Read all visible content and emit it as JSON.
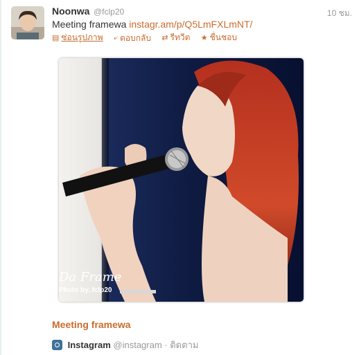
{
  "tweet": {
    "author_name": "Noonwa",
    "author_handle": "@fclp20",
    "time": "10 ชม.",
    "text": "Meeting framewa",
    "link": "instagr.am/p/Q5LmFXLmNT/",
    "actions": [
      {
        "label": "ซ่อนรูปภาพ",
        "icon": "image-icon"
      },
      {
        "label": "ตอบกลับ",
        "icon": "reply-icon"
      },
      {
        "label": "รีทวีต",
        "icon": "retweet-icon"
      },
      {
        "label": "ชื่นชอบ",
        "icon": "star-icon"
      }
    ]
  },
  "photo": {
    "watermark_script": "Da Frame",
    "watermark_credit": "Photo by..fclp20"
  },
  "card": {
    "title": "Meeting framewa",
    "source_name": "Instagram",
    "source_handle": "@instagram",
    "follow_label": "· ติดตาม"
  },
  "colors": {
    "link": "#c96c2e",
    "muted": "#999999",
    "text": "#333333"
  }
}
